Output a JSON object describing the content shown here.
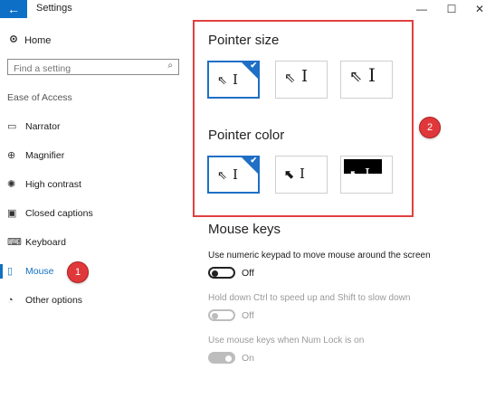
{
  "window": {
    "title": "Settings",
    "back_icon": "←",
    "minimize_icon": "—",
    "maximize_icon": "☐",
    "close_icon": "✕"
  },
  "sidebar": {
    "home_label": "Home",
    "search_placeholder": "Find a setting",
    "section_label": "Ease of Access",
    "items": [
      {
        "label": "Narrator",
        "icon": "narrator-icon"
      },
      {
        "label": "Magnifier",
        "icon": "magnifier-icon"
      },
      {
        "label": "High contrast",
        "icon": "high-contrast-icon"
      },
      {
        "label": "Closed captions",
        "icon": "closed-captions-icon"
      },
      {
        "label": "Keyboard",
        "icon": "keyboard-icon"
      },
      {
        "label": "Mouse",
        "icon": "mouse-icon",
        "active": true
      },
      {
        "label": "Other options",
        "icon": "other-options-icon"
      }
    ]
  },
  "badges": {
    "one": "1",
    "two": "2"
  },
  "main": {
    "pointer_size_heading": "Pointer size",
    "pointer_color_heading": "Pointer color",
    "check_glyph": "✔",
    "mouse_keys_heading": "Mouse keys",
    "toggles": [
      {
        "caption": "Use numeric keypad to move mouse around the screen",
        "state": "Off",
        "enabled": true
      },
      {
        "caption": "Hold down Ctrl to speed up and Shift to slow down",
        "state": "Off",
        "enabled": false
      },
      {
        "caption": "Use mouse keys when Num Lock is on",
        "state": "On",
        "enabled": false
      }
    ]
  },
  "colors": {
    "accent": "#1170c0",
    "highlight_border": "#e04040",
    "badge": "#e0383a"
  }
}
